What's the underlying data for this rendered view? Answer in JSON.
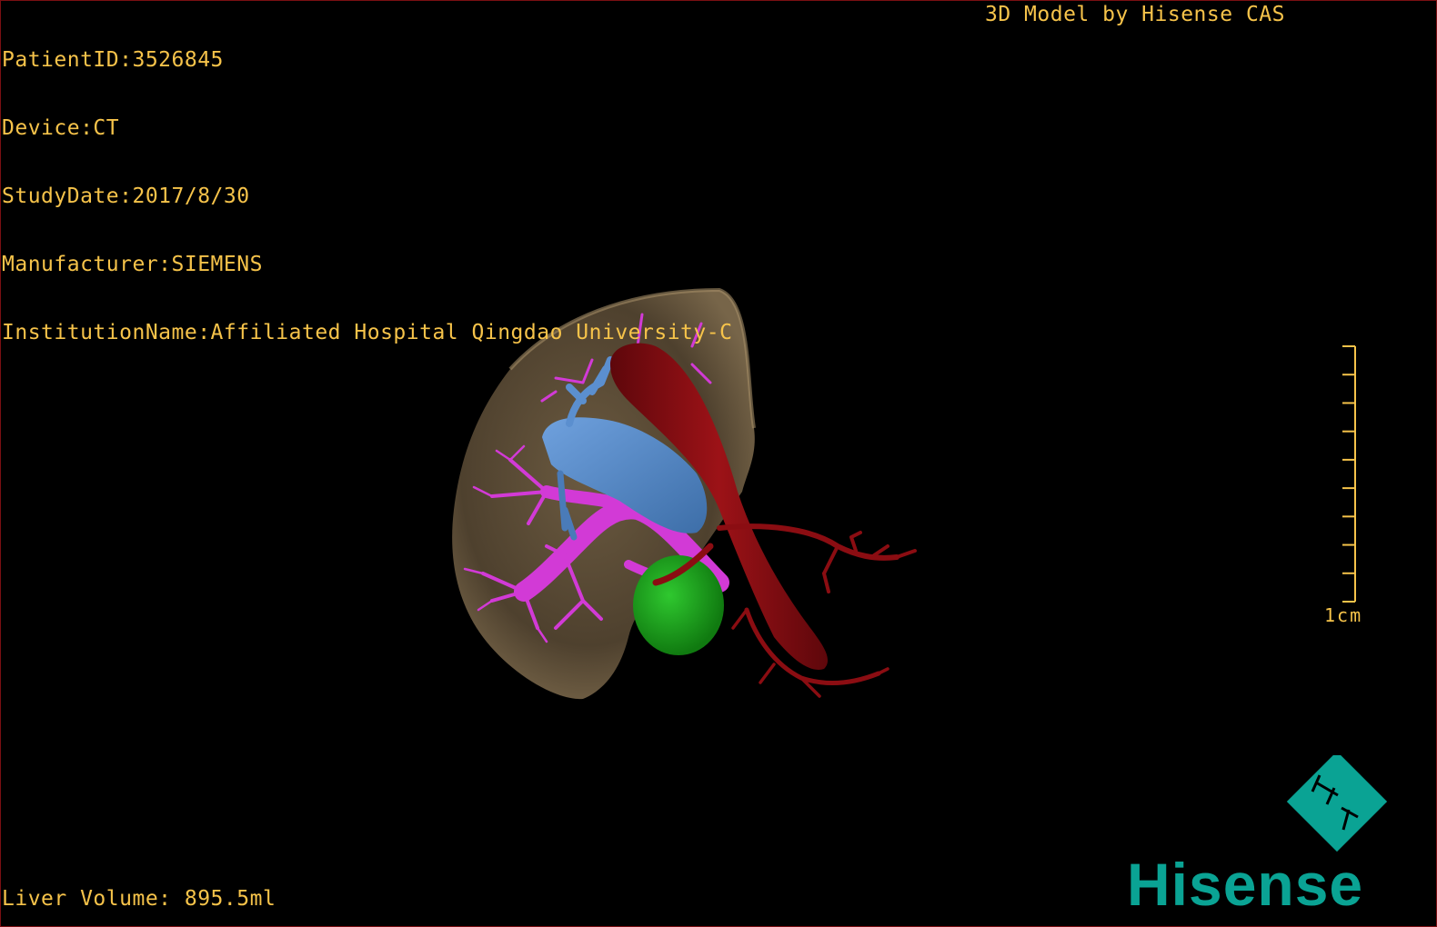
{
  "metadata": {
    "patient_id": "PatientID:3526845",
    "device": "Device:CT",
    "study_date": "StudyDate:2017/8/30",
    "manufacturer": "Manufacturer:SIEMENS",
    "institution": "InstitutionName:Affiliated Hospital Qingdao University-C"
  },
  "model_credit": "3D Model by Hisense CAS",
  "liver_volume": "Liver Volume: 895.5ml",
  "scale_bar": {
    "label": "1cm",
    "tick_count": 10
  },
  "brand": {
    "name": "Hisense",
    "color": "#0aa394"
  },
  "colors": {
    "overlay_text": "#f6c34a",
    "liver": "#8a7452",
    "artery": "#8b0d12",
    "portal_vein": "#d23ad6",
    "hepatic_vein": "#5b8fcf",
    "gallbladder": "#1ea61e",
    "frame": "#7a0f12"
  }
}
